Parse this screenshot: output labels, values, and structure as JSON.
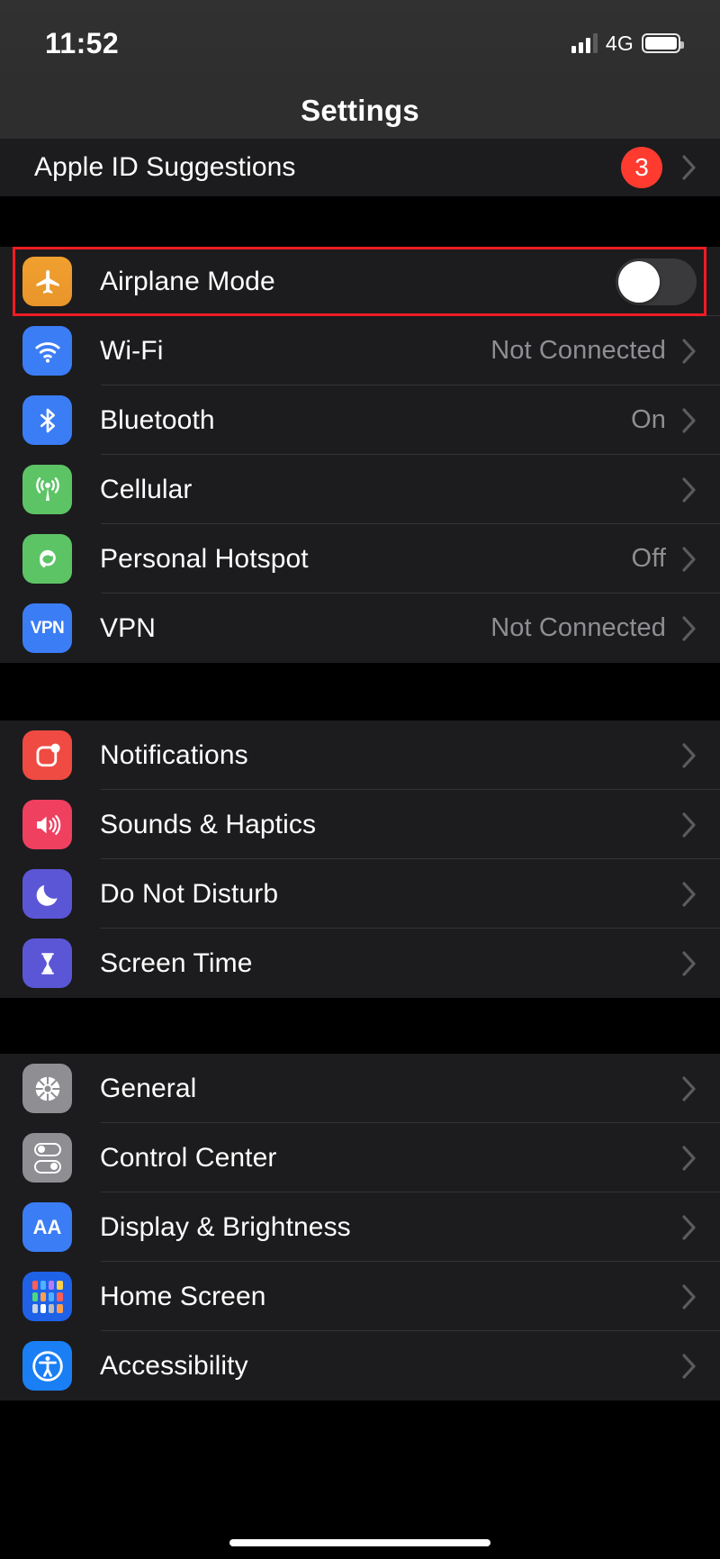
{
  "status_bar": {
    "time": "11:52",
    "network_type": "4G",
    "signal_icon": "cellular-bars-icon",
    "battery_icon": "battery-full-icon",
    "signal_bars_filled": 3,
    "signal_bars_total": 4
  },
  "navbar": {
    "title": "Settings"
  },
  "apple_id": {
    "label": "Apple ID Suggestions",
    "badge": "3",
    "chevron": "chevron-right-icon"
  },
  "colors": {
    "accent_red": "#ff3b30",
    "annotation_red": "#ee1c24",
    "row_background": "#1c1c1e",
    "page_background": "#000000",
    "secondary_text": "#8e8e93"
  },
  "groups": [
    {
      "name": "connectivity",
      "rows": [
        {
          "label": "Airplane Mode",
          "icon": "airplane-icon",
          "icon_class": "ic-airplane",
          "control": "toggle",
          "toggle_on": false,
          "highlighted": true
        },
        {
          "label": "Wi-Fi",
          "icon": "wifi-icon",
          "icon_class": "ic-wifi",
          "value": "Not Connected",
          "control": "chevron"
        },
        {
          "label": "Bluetooth",
          "icon": "bluetooth-icon",
          "icon_class": "ic-bt",
          "value": "On",
          "control": "chevron"
        },
        {
          "label": "Cellular",
          "icon": "cellular-antenna-icon",
          "icon_class": "ic-cell",
          "value": "",
          "control": "chevron"
        },
        {
          "label": "Personal Hotspot",
          "icon": "hotspot-link-icon",
          "icon_class": "ic-hotspot",
          "value": "Off",
          "control": "chevron"
        },
        {
          "label": "VPN",
          "icon": "vpn-icon",
          "icon_class": "ic-vpn",
          "value": "Not Connected",
          "control": "chevron"
        }
      ]
    },
    {
      "name": "notifications",
      "rows": [
        {
          "label": "Notifications",
          "icon": "notifications-badge-icon",
          "icon_class": "ic-notif",
          "value": "",
          "control": "chevron"
        },
        {
          "label": "Sounds & Haptics",
          "icon": "speaker-waves-icon",
          "icon_class": "ic-sound",
          "value": "",
          "control": "chevron"
        },
        {
          "label": "Do Not Disturb",
          "icon": "moon-icon",
          "icon_class": "ic-dnd",
          "value": "",
          "control": "chevron"
        },
        {
          "label": "Screen Time",
          "icon": "hourglass-icon",
          "icon_class": "ic-screen",
          "value": "",
          "control": "chevron"
        }
      ]
    },
    {
      "name": "system",
      "rows": [
        {
          "label": "General",
          "icon": "gear-icon",
          "icon_class": "ic-general",
          "value": "",
          "control": "chevron"
        },
        {
          "label": "Control Center",
          "icon": "toggles-icon",
          "icon_class": "ic-control",
          "value": "",
          "control": "chevron"
        },
        {
          "label": "Display & Brightness",
          "icon": "text-size-aa-icon",
          "icon_class": "ic-display",
          "value": "",
          "control": "chevron"
        },
        {
          "label": "Home Screen",
          "icon": "app-grid-icon",
          "icon_class": "ic-home",
          "value": "",
          "control": "chevron"
        },
        {
          "label": "Accessibility",
          "icon": "accessibility-person-icon",
          "icon_class": "ic-access",
          "value": "",
          "control": "chevron"
        }
      ]
    }
  ],
  "vpn_icon_text": "VPN",
  "display_icon_text": "AA",
  "home_indicator": "home-indicator"
}
